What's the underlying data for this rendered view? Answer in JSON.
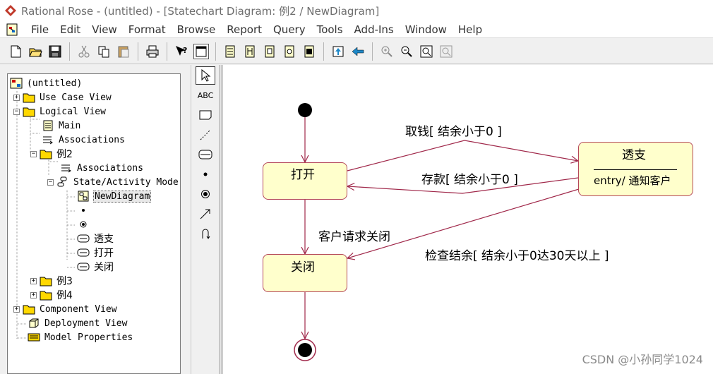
{
  "window": {
    "title": "Rational Rose - (untitled) - [Statechart Diagram: 例2 / NewDiagram]"
  },
  "menu": [
    "File",
    "Edit",
    "View",
    "Format",
    "Browse",
    "Report",
    "Query",
    "Tools",
    "Add-Ins",
    "Window",
    "Help"
  ],
  "toolbar": [
    "new-icon",
    "open-icon",
    "save-icon",
    "cut-icon",
    "copy-icon",
    "paste-icon",
    "print-icon",
    "context-help-icon",
    "view-doc-icon",
    "browse-class-diagram-icon",
    "browse-interaction-diagram-icon",
    "browse-component-diagram-icon",
    "browse-deployment-diagram-icon",
    "browse-state-diagram-icon",
    "browse-parent-icon",
    "browse-previous-icon",
    "zoom-in-icon",
    "zoom-out-icon",
    "fit-in-window-icon",
    "undo-fit-icon"
  ],
  "browser": {
    "root": "(untitled)",
    "use_case_view": "Use Case View",
    "logical_view": "Logical View",
    "main": "Main",
    "associations": "Associations",
    "example2": "例2",
    "example2_associations": "Associations",
    "state_activity_model": "State/Activity Mode",
    "new_diagram": "NewDiagram",
    "state_overdraft": "透支",
    "state_open": "打开",
    "state_closed": "关闭",
    "example3": "例3",
    "example4": "例4",
    "component_view": "Component View",
    "deployment_view": "Deployment View",
    "model_properties": "Model Properties"
  },
  "palette": {
    "text_tool_label": "ABC",
    "tools": [
      "selection-tool",
      "text-tool",
      "note-tool",
      "anchor-note-tool",
      "state-tool",
      "start-state-tool",
      "end-state-tool",
      "state-transition-tool",
      "self-transition-tool"
    ]
  },
  "diagram": {
    "states": {
      "open": {
        "name": "打开"
      },
      "closed": {
        "name": "关闭"
      },
      "overdraft": {
        "name": "透支",
        "action": "entry/ 通知客户"
      }
    },
    "transitions": {
      "withdraw": "取钱[ 结余小于0 ]",
      "deposit": "存款[ 结余小于0 ]",
      "customer_close": "客户请求关闭",
      "check_balance": "检查结余[ 结余小于0达30天以上 ]"
    },
    "line_color": "#a0284a",
    "state_fill": "#ffffcc"
  },
  "watermark": "CSDN @小孙同学1024"
}
